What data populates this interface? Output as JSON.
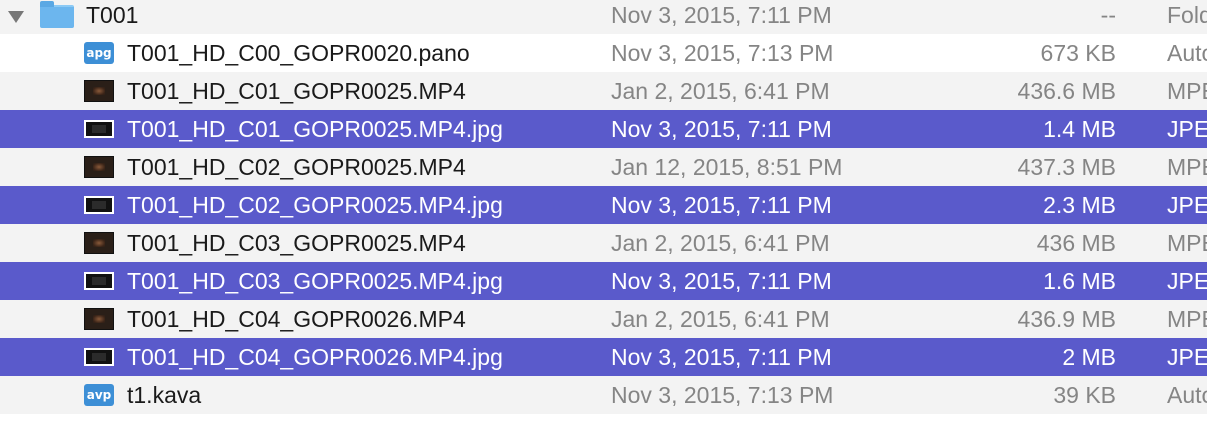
{
  "folder": {
    "name": "T001",
    "date": "Nov 3, 2015, 7:11 PM",
    "size": "--",
    "kind": "Fold"
  },
  "files": [
    {
      "name": "T001_HD_C00_GOPR0020.pano",
      "date": "Nov 3, 2015, 7:13 PM",
      "size": "673 KB",
      "kind": "Auto",
      "icon": "apg-app-icon",
      "icon_text": "apg"
    },
    {
      "name": "T001_HD_C01_GOPR0025.MP4",
      "date": "Jan 2, 2015, 6:41 PM",
      "size": "436.6 MB",
      "kind": "MPE",
      "icon": "video-thumbnail-icon"
    },
    {
      "name": "T001_HD_C01_GOPR0025.MP4.jpg",
      "date": "Nov 3, 2015, 7:11 PM",
      "size": "1.4 MB",
      "kind": "JPE",
      "icon": "image-thumbnail-icon"
    },
    {
      "name": "T001_HD_C02_GOPR0025.MP4",
      "date": "Jan 12, 2015, 8:51 PM",
      "size": "437.3 MB",
      "kind": "MPE",
      "icon": "video-thumbnail-icon"
    },
    {
      "name": "T001_HD_C02_GOPR0025.MP4.jpg",
      "date": "Nov 3, 2015, 7:11 PM",
      "size": "2.3 MB",
      "kind": "JPE",
      "icon": "image-thumbnail-icon"
    },
    {
      "name": "T001_HD_C03_GOPR0025.MP4",
      "date": "Jan 2, 2015, 6:41 PM",
      "size": "436 MB",
      "kind": "MPE",
      "icon": "video-thumbnail-icon"
    },
    {
      "name": "T001_HD_C03_GOPR0025.MP4.jpg",
      "date": "Nov 3, 2015, 7:11 PM",
      "size": "1.6 MB",
      "kind": "JPE",
      "icon": "image-thumbnail-icon"
    },
    {
      "name": "T001_HD_C04_GOPR0026.MP4",
      "date": "Jan 2, 2015, 6:41 PM",
      "size": "436.9 MB",
      "kind": "MPE",
      "icon": "video-thumbnail-icon"
    },
    {
      "name": "T001_HD_C04_GOPR0026.MP4.jpg",
      "date": "Nov 3, 2015, 7:11 PM",
      "size": "2 MB",
      "kind": "JPE",
      "icon": "image-thumbnail-icon"
    },
    {
      "name": "t1.kava",
      "date": "Nov 3, 2015, 7:13 PM",
      "size": "39 KB",
      "kind": "Auto",
      "icon": "avp-app-icon",
      "icon_text": "avp"
    }
  ],
  "colors": {
    "selection": "#5a5acb",
    "alt_row": "#f3f3f3",
    "secondary_text": "#858585"
  }
}
